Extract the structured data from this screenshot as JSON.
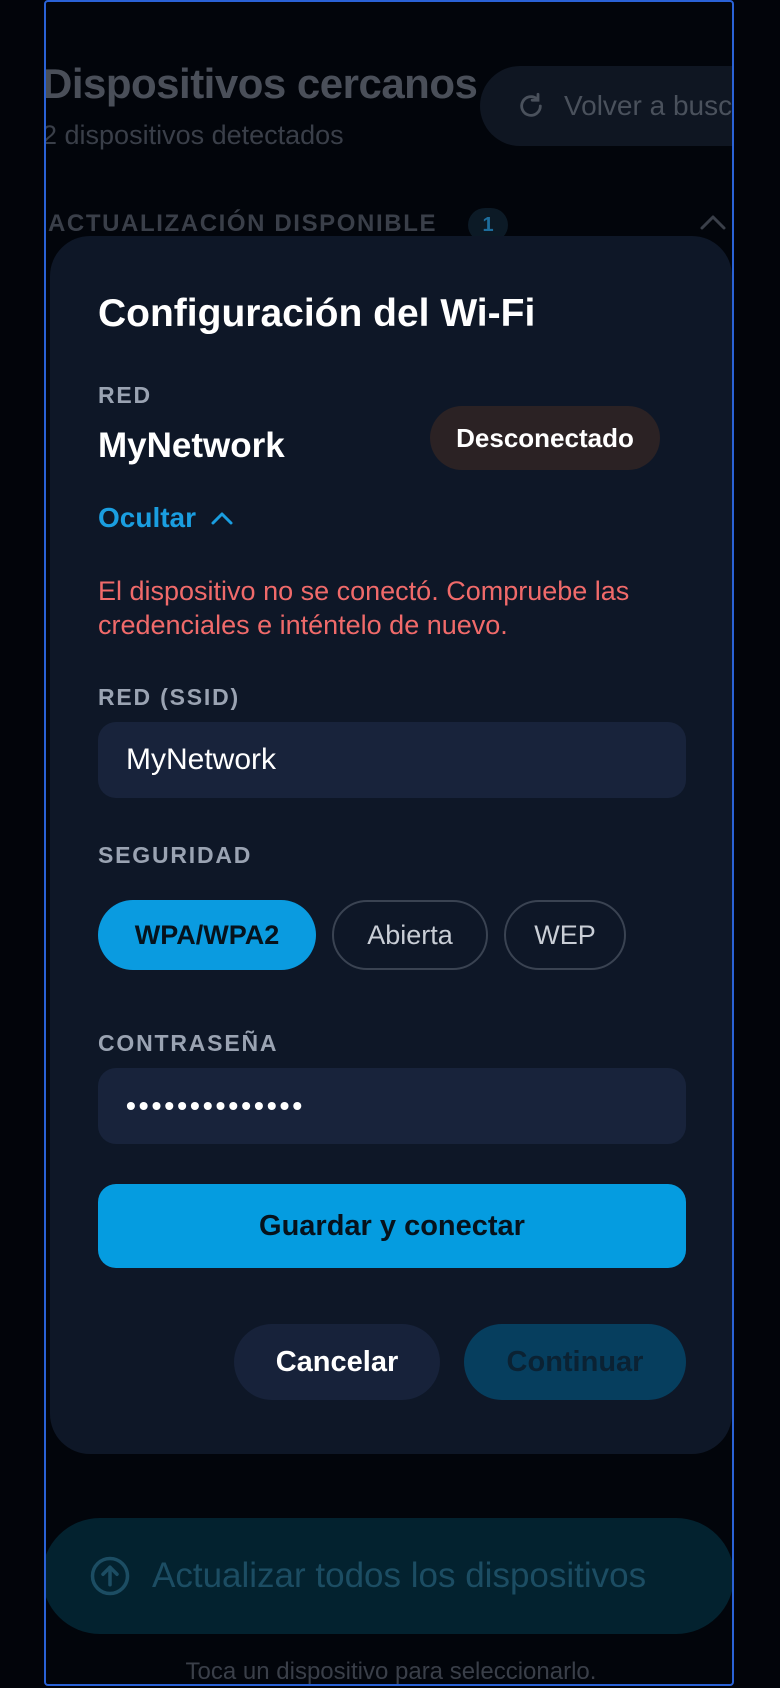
{
  "background": {
    "title": "Dispositivos cercanos",
    "subtitle": "2 dispositivos detectados",
    "rescan_label": "Volver a buscar",
    "rescan_icon": "refresh-icon",
    "section_label": "ACTUALIZACIÓN DISPONIBLE",
    "section_count": "1",
    "section_icon": "chevron-up-icon",
    "update_all_label": "Actualizar todos los dispositivos",
    "update_all_icon": "arrow-up-circle-icon",
    "hint": "Toca un dispositivo para seleccionarlo."
  },
  "modal": {
    "title": "Configuración del Wi-Fi",
    "network_label": "RED",
    "network_name": "MyNetwork",
    "status": "Desconectado",
    "toggle_label": "Ocultar",
    "toggle_icon": "chevron-up-icon",
    "error": "El dispositivo no se conectó. Compruebe las credenciales e inténtelo de nuevo.",
    "ssid_label": "RED (SSID)",
    "ssid_value": "MyNetwork",
    "security_label": "SEGURIDAD",
    "security_options": [
      "WPA/WPA2",
      "Abierta",
      "WEP"
    ],
    "security_selected": "WPA/WPA2",
    "password_label": "CONTRASEÑA",
    "password_value": "••••••••••••••",
    "save_label": "Guardar y conectar",
    "cancel_label": "Cancelar",
    "continue_label": "Continuar"
  },
  "colors": {
    "accent": "#059ce0",
    "error": "#f06a6a",
    "modal_bg": "#0e1727",
    "field_bg": "#18233b"
  }
}
